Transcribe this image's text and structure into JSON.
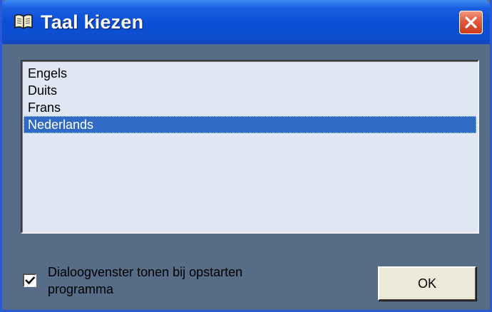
{
  "window": {
    "title": "Taal kiezen",
    "title_icon": "book-icon",
    "close_icon": "close-icon"
  },
  "languages": {
    "items": [
      {
        "label": "Engels"
      },
      {
        "label": "Duits"
      },
      {
        "label": "Frans"
      },
      {
        "label": "Nederlands"
      }
    ],
    "selected_index": 3
  },
  "startup_option": {
    "checked": true,
    "label": "Dialoogvenster tonen bij opstarten programma"
  },
  "buttons": {
    "ok_label": "OK"
  },
  "colors": {
    "titlebar": "#0a4fd6",
    "dialog_background": "#566c87",
    "list_background": "#dfe7f3",
    "selection": "#316ac5",
    "close_button": "#e0583a"
  }
}
